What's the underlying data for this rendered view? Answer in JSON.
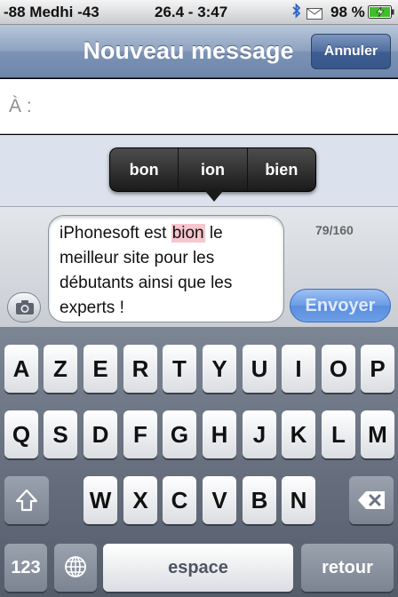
{
  "status_bar": {
    "carrier": "-88 Medhi  -43",
    "time": "26.4 - 3:47",
    "battery_pct": "98 %",
    "icons": [
      "bluetooth-icon",
      "mail-icon",
      "battery-charging-icon"
    ]
  },
  "nav": {
    "title": "Nouveau message",
    "cancel_label": "Annuler"
  },
  "to_field": {
    "label": "À :"
  },
  "suggestions": [
    "bon",
    "ion",
    "bien"
  ],
  "compose": {
    "text_before": "iPhonesoft est ",
    "misspelled_word": "bion",
    "text_after": " le meilleur site pour les débutants ainsi que les experts !",
    "char_count": "79/160",
    "send_label": "Envoyer",
    "camera_icon": "camera-icon"
  },
  "keyboard": {
    "row1": [
      "A",
      "Z",
      "E",
      "R",
      "T",
      "Y",
      "U",
      "I",
      "O",
      "P"
    ],
    "row2": [
      "Q",
      "S",
      "D",
      "F",
      "G",
      "H",
      "J",
      "K",
      "L",
      "M"
    ],
    "row3": [
      "W",
      "X",
      "C",
      "V",
      "B",
      "N"
    ],
    "numbers_label": "123",
    "space_label": "espace",
    "return_label": "retour",
    "shift_icon": "shift-icon",
    "globe_icon": "globe-icon",
    "delete_icon": "backspace-icon"
  },
  "colors": {
    "nav_blue": "#6d86ab",
    "send_blue": "#6a9be4",
    "highlight": "#f7c6cd"
  }
}
